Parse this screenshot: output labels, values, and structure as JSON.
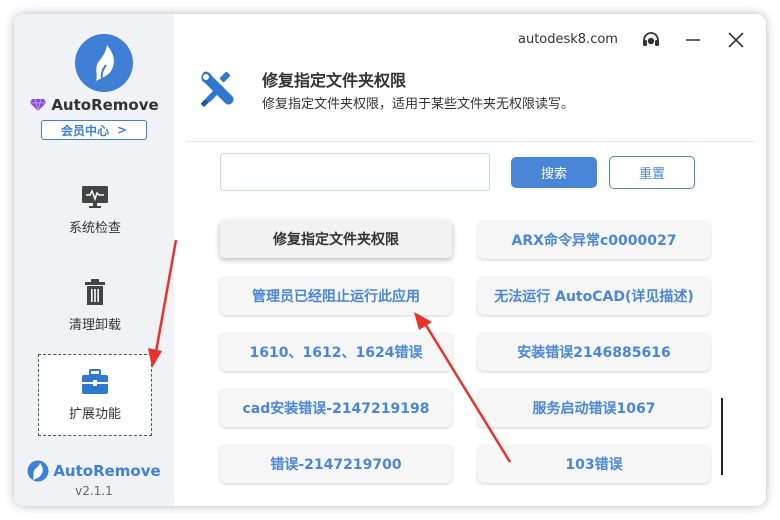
{
  "sidebar": {
    "brand": "AutoRemove",
    "member_center": "会员中心",
    "member_arrow": ">",
    "nav": [
      {
        "label": "系统检查",
        "icon": "monitor-icon"
      },
      {
        "label": "清理卸载",
        "icon": "trash-icon"
      },
      {
        "label": "扩展功能",
        "icon": "toolbox-icon",
        "active": true
      }
    ],
    "footer_brand": "AutoRemove",
    "version": "v2.1.1"
  },
  "titlebar": {
    "site": "autodesk8.com",
    "icons": [
      "headset-icon",
      "minimize-icon",
      "close-icon"
    ]
  },
  "header": {
    "icon": "wrench-screwdriver-icon",
    "title": "修复指定文件夹权限",
    "subtitle": "修复指定文件夹权限，适用于某些文件夹无权限读写。"
  },
  "search": {
    "value": "",
    "placeholder": "",
    "search_label": "搜索",
    "reset_label": "重置"
  },
  "functions": [
    {
      "label": "修复指定文件夹权限",
      "selected": true
    },
    {
      "label": "ARX命令异常c0000027"
    },
    {
      "label": "管理员已经阻止运行此应用"
    },
    {
      "label": "无法运行 AutoCAD(详见描述)"
    },
    {
      "label": "1610、1612、1624错误"
    },
    {
      "label": "安装错误2146885616"
    },
    {
      "label": "cad安装错误-2147219198"
    },
    {
      "label": "服务启动错误1067"
    },
    {
      "label": "错误-2147219700"
    },
    {
      "label": "103错误"
    }
  ],
  "colors": {
    "accent": "#4a86d8",
    "sidebar_bg": "#f0f2f5",
    "annotation_arrow": "#e8322b",
    "brand_gem": "#8a4fd6"
  }
}
